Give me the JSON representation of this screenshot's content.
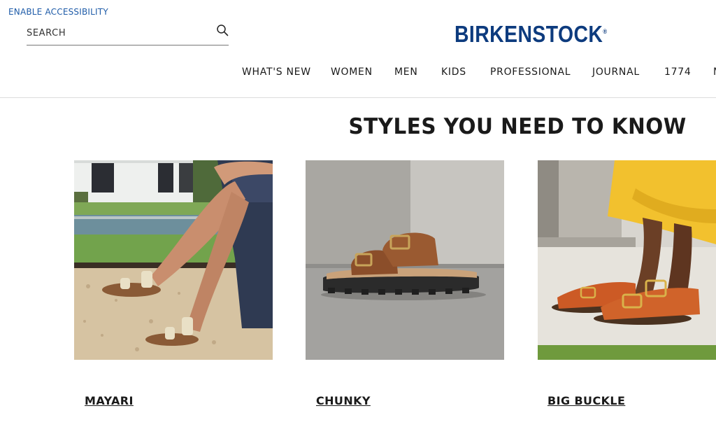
{
  "header": {
    "accessibility_link": "ENABLE ACCESSIBILITY",
    "search": {
      "placeholder": "SEARCH"
    },
    "logo": "BIRKENSTOCK",
    "logo_mark": "®",
    "brand_color": "#0d3b7e",
    "nav": [
      {
        "label": "WHAT'S NEW"
      },
      {
        "label": "WOMEN"
      },
      {
        "label": "MEN"
      },
      {
        "label": "KIDS"
      },
      {
        "label": "PROFESSIONAL"
      },
      {
        "label": "JOURNAL"
      },
      {
        "label": "1774"
      },
      {
        "label": "M"
      }
    ]
  },
  "section": {
    "title": "STYLES YOU NEED TO KNOW",
    "cards": [
      {
        "label": "MAYARI",
        "image": "woman-seated-crossed-legs-wearing-cream-mayari-sandals-on-gravel"
      },
      {
        "label": "CHUNKY",
        "image": "brown-suede-two-strap-sandal-on-chunky-black-sole"
      },
      {
        "label": "BIG BUCKLE",
        "image": "feet-in-orange-big-buckle-sandals-with-yellow-skirt"
      }
    ]
  }
}
